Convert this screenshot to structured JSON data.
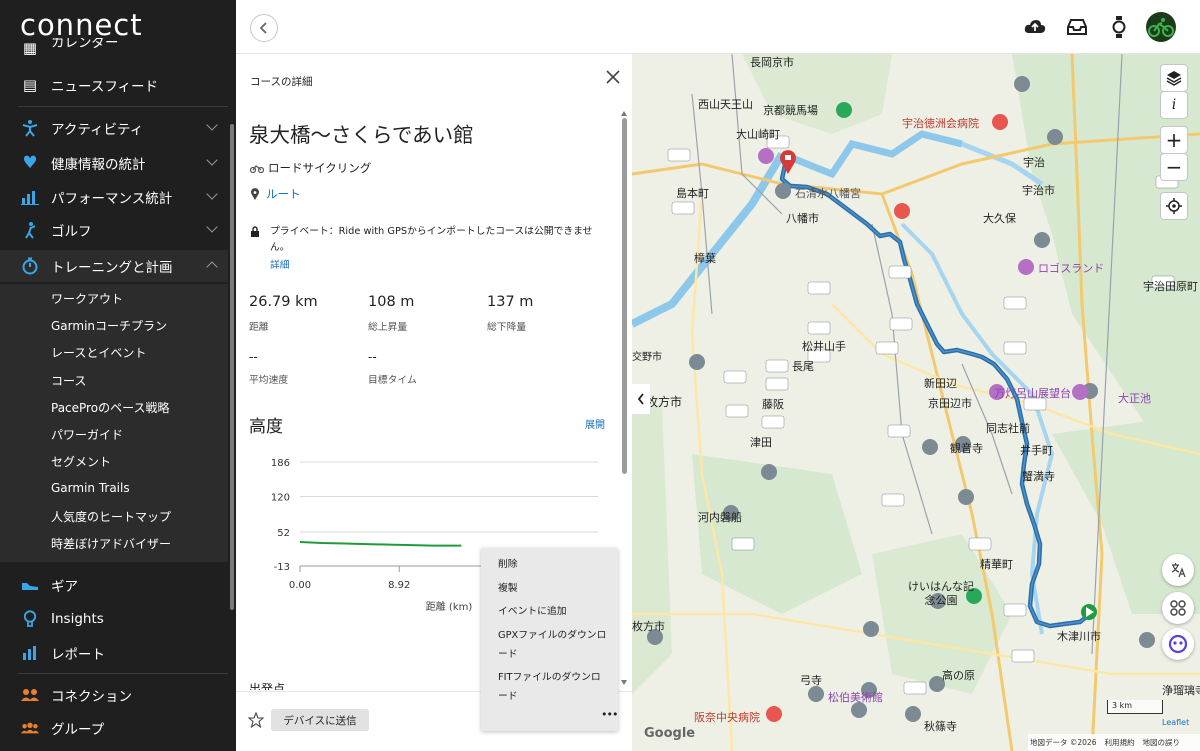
{
  "sidebar": {
    "logo": "connect",
    "items": [
      {
        "label": "カレンダー",
        "icon": "calendar-icon"
      },
      {
        "label": "ニュースフィード",
        "icon": "newsfeed-icon"
      },
      {
        "label": "アクティビティ",
        "icon": "activity-icon"
      },
      {
        "label": "健康情報の統計",
        "icon": "heart-icon"
      },
      {
        "label": "パフォーマンス統計",
        "icon": "bar-chart-icon"
      },
      {
        "label": "ゴルフ",
        "icon": "golf-icon"
      },
      {
        "label": "トレーニングと計画",
        "icon": "stopwatch-icon"
      },
      {
        "label": "ギア",
        "icon": "shoe-icon"
      },
      {
        "label": "Insights",
        "icon": "lightbulb-icon"
      },
      {
        "label": "レポート",
        "icon": "report-icon"
      },
      {
        "label": "コネクション",
        "icon": "people-icon"
      },
      {
        "label": "グループ",
        "icon": "group-icon"
      }
    ],
    "training_sub": [
      "ワークアウト",
      "Garminコーチプラン",
      "レースとイベント",
      "コース",
      "PaceProのペース戦略",
      "パワーガイド",
      "セグメント",
      "Garmin Trails",
      "人気度のヒートマップ",
      "時差ぼけアドバイザー"
    ]
  },
  "topbar": {
    "icons": [
      "upload-icon",
      "inbox-icon",
      "watch-icon",
      "avatar-cyclist-icon"
    ],
    "accent": "#39b54a"
  },
  "panel": {
    "header": "コースの詳細",
    "course_name": "泉大橋〜さくらであい館",
    "activity_type": "ロードサイクリング",
    "route_label": "ルート",
    "privacy_text": "プライベート：Ride with GPSからインポートしたコースは公開できません。",
    "details_link": "詳細",
    "stats": [
      {
        "value": "26.79 km",
        "label": "距離"
      },
      {
        "value": "108 m",
        "label": "総上昇量"
      },
      {
        "value": "137 m",
        "label": "総下降量"
      },
      {
        "value": "--",
        "label": "平均速度"
      },
      {
        "value": "--",
        "label": "目標タイム"
      }
    ],
    "elevation_title": "高度",
    "expand_label": "展開",
    "next_section_partial": "出発点",
    "send_button": "デバイスに送信",
    "accent_link": "#1670c4"
  },
  "chart_data": {
    "type": "line",
    "title": "",
    "xlabel": "距離 (km)",
    "ylabel": "",
    "y_ticks": [
      186,
      120,
      52,
      -13
    ],
    "x_ticks": [
      "0.00",
      "8.92"
    ],
    "ylim": [
      -13,
      186
    ],
    "xlim": [
      0,
      26.79
    ],
    "series": [
      {
        "x": [
          0,
          2,
          4,
          6,
          8,
          10,
          12,
          14.5
        ],
        "y": [
          33,
          31,
          30,
          29,
          28,
          27,
          26,
          26
        ]
      }
    ],
    "color": "#1f9a3c",
    "grid": true
  },
  "context_menu": {
    "items": [
      "削除",
      "複製",
      "イベントに追加",
      "GPXファイルのダウンロード",
      "FITファイルのダウンロード"
    ],
    "more": "•••"
  },
  "map": {
    "labels": [
      "長岡京市",
      "西山天王山",
      "京都競馬場",
      "大山崎町",
      "宇治徳洲会病院",
      "宇治",
      "宇治市",
      "島本町",
      "石清水八幡宮",
      "八幡市",
      "大久保",
      "ロゴスランド",
      "樟葉",
      "宇治田原町",
      "松井山手",
      "長尾",
      "新田辺",
      "京田辺市",
      "万灯呂山展望台",
      "大正池",
      "枚方市",
      "藤阪",
      "津田",
      "観音寺",
      "同志社前",
      "井手町",
      "蟹満寺",
      "河内磐船",
      "精華町",
      "けいはんな記念公園",
      "木津川市",
      "高の原",
      "松伯美術館",
      "阪奈中央病院",
      "秋篠寺",
      "浄瑠璃寺",
      "弓寺",
      "交野市",
      "枚方市"
    ],
    "scale": "3 km",
    "attribution_leaflet": "Leaflet",
    "attribution_data": "地図データ ©2026",
    "attribution_terms": "利用規約",
    "attribution_report": "地図の誤り",
    "google": "Google",
    "info_btn": "i",
    "zoom_in": "+",
    "zoom_out": "−"
  }
}
